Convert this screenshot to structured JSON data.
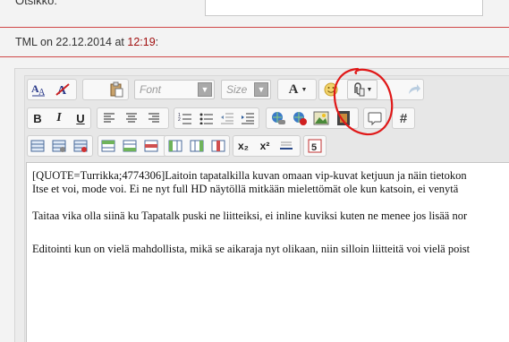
{
  "subject": {
    "label": "Otsikko:",
    "value": ""
  },
  "post_meta": {
    "author": "TML",
    "on": "on",
    "date": "22.12.2014",
    "at": "at",
    "time": "12:19",
    "colon": ":"
  },
  "toolbar": {
    "font_placeholder": "Font",
    "size_placeholder": "Size",
    "text_color_label": "A",
    "bold": "B",
    "italic": "I",
    "underline": "U",
    "hash": "#",
    "subscript": "x₂",
    "superscript": "x²"
  },
  "message": {
    "line1": "[QUOTE=Turrikka;4774306]Laitoin tapatalkilla kuvan omaan vip-kuvat ketjuun ja näin tietokon",
    "line2": "Itse et voi, mode voi. Ei ne nyt full HD näytöllä mitkään mielettömät ole kun katsoin, ei venytä",
    "line3": "Taitaa vika olla siinä ku Tapatalk puski ne liitteiksi, ei inline kuviksi kuten ne menee jos lisää nor",
    "line4": "Editointi kun on vielä mahdollista, mikä se aikaraja nyt olikaan, niin silloin liitteitä voi vielä poist"
  },
  "colors": {
    "accent_red": "#d04848",
    "time_red": "#a01010",
    "annotation_red": "#e01818"
  }
}
